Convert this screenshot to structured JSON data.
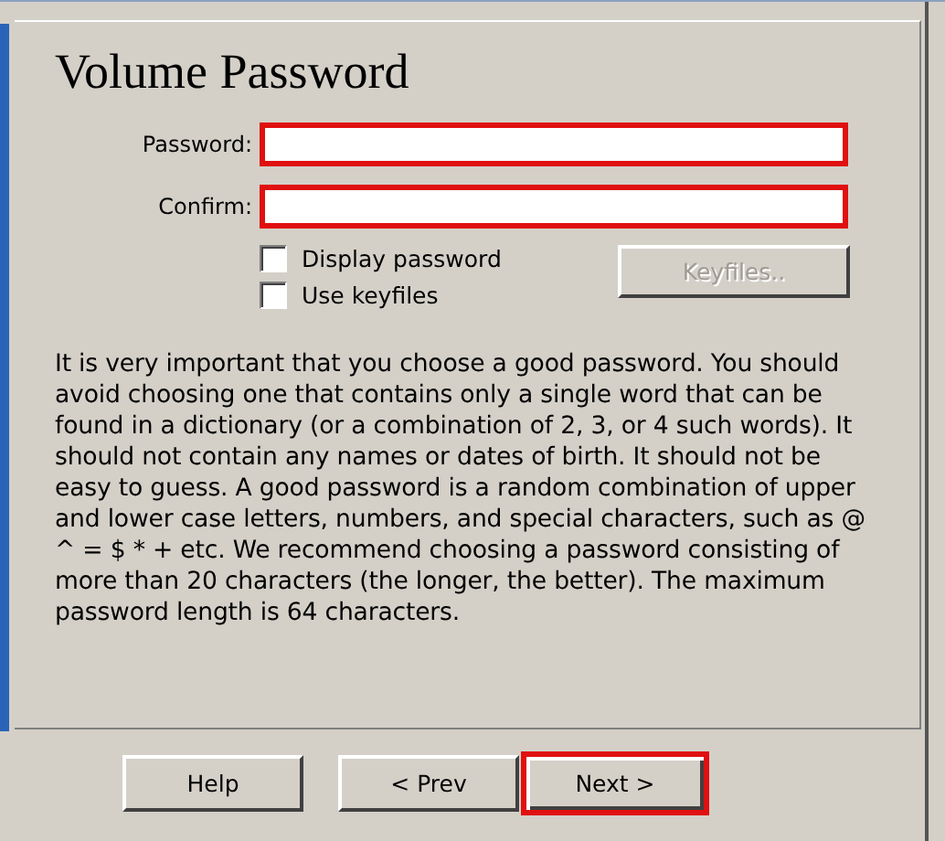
{
  "title": "Volume Password",
  "fields": [
    {
      "label": "Password:",
      "highlighted": true
    },
    {
      "label": "Confirm:",
      "highlighted": true
    }
  ],
  "checkboxes": [
    {
      "label": "Display password",
      "checked": false
    },
    {
      "label": "Use keyfiles",
      "checked": false
    }
  ],
  "keyfiles_button": {
    "label": "Keyfiles..",
    "disabled": true
  },
  "description": "It is very important that you choose a good password. You should avoid choosing one that contains only a single word that can be found in a dictionary (or a combination of 2, 3, or 4 such words). It should not contain any names or dates of birth. It should not be easy to guess. A good password is a random combination of upper and lower case letters, numbers, and special characters, such as @ ^ = $ * + etc. We recommend choosing a password consisting of more than 20 characters (the longer, the better). The maximum password length is 64 characters.",
  "buttons": [
    {
      "label": "Help",
      "highlighted": false
    },
    {
      "label": "< Prev",
      "highlighted": false
    },
    {
      "label": "Next >",
      "highlighted": true
    }
  ]
}
